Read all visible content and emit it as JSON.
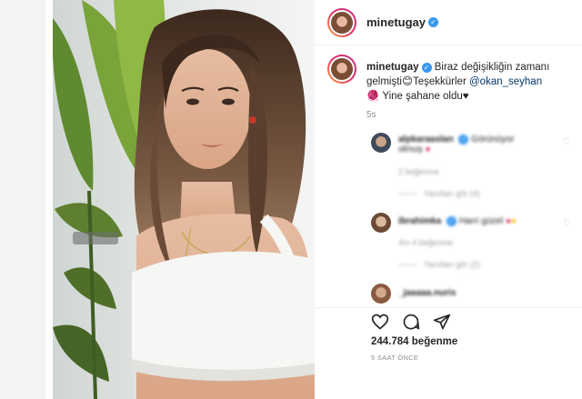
{
  "post": {
    "username": "minetugay",
    "caption_text": "Biraz değişikliğin zamanı gelmişti",
    "thanks_text": "Teşekkürler",
    "mention": "@okan_seyhan",
    "line2_text": "Yine şahane oldu",
    "age": "5s",
    "likes_count": "244.784",
    "likes_word": "beğenme",
    "timestamp": "5 SAAT ÖNCE"
  },
  "comments": [
    {
      "username": "alpkaraaslan",
      "text": "Görünüyor",
      "text2": "olmuş",
      "meta": "2 beğenme",
      "replies": "Yanıtları gör (4)"
    },
    {
      "username": "ibrahimka",
      "text": "Harri güzel",
      "meta": "4m   4 beğenme",
      "replies": "Yanıtları gör (2)"
    },
    {
      "username": "_jaaaaa.nuris",
      "text": ""
    }
  ],
  "icons": [
    "verified-badge-icon",
    "heart-icon",
    "comment-icon",
    "share-icon",
    "emoji-icon"
  ],
  "colors": {
    "verified": "#3897f0",
    "mention": "#00376b",
    "text": "#262626",
    "muted": "#8e8e8e"
  }
}
